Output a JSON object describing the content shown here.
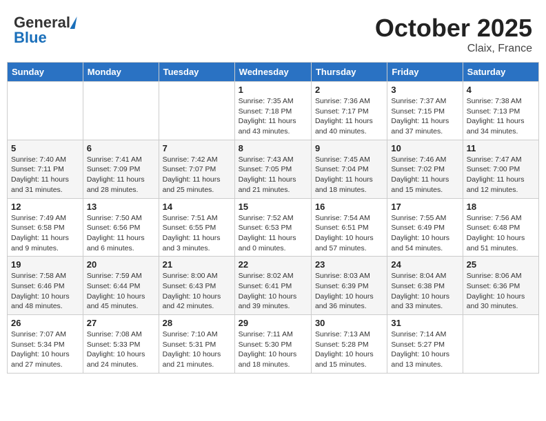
{
  "header": {
    "logo_general": "General",
    "logo_blue": "Blue",
    "month": "October 2025",
    "location": "Claix, France"
  },
  "weekdays": [
    "Sunday",
    "Monday",
    "Tuesday",
    "Wednesday",
    "Thursday",
    "Friday",
    "Saturday"
  ],
  "weeks": [
    [
      {
        "day": "",
        "info": ""
      },
      {
        "day": "",
        "info": ""
      },
      {
        "day": "",
        "info": ""
      },
      {
        "day": "1",
        "info": "Sunrise: 7:35 AM\nSunset: 7:18 PM\nDaylight: 11 hours and 43 minutes."
      },
      {
        "day": "2",
        "info": "Sunrise: 7:36 AM\nSunset: 7:17 PM\nDaylight: 11 hours and 40 minutes."
      },
      {
        "day": "3",
        "info": "Sunrise: 7:37 AM\nSunset: 7:15 PM\nDaylight: 11 hours and 37 minutes."
      },
      {
        "day": "4",
        "info": "Sunrise: 7:38 AM\nSunset: 7:13 PM\nDaylight: 11 hours and 34 minutes."
      }
    ],
    [
      {
        "day": "5",
        "info": "Sunrise: 7:40 AM\nSunset: 7:11 PM\nDaylight: 11 hours and 31 minutes."
      },
      {
        "day": "6",
        "info": "Sunrise: 7:41 AM\nSunset: 7:09 PM\nDaylight: 11 hours and 28 minutes."
      },
      {
        "day": "7",
        "info": "Sunrise: 7:42 AM\nSunset: 7:07 PM\nDaylight: 11 hours and 25 minutes."
      },
      {
        "day": "8",
        "info": "Sunrise: 7:43 AM\nSunset: 7:05 PM\nDaylight: 11 hours and 21 minutes."
      },
      {
        "day": "9",
        "info": "Sunrise: 7:45 AM\nSunset: 7:04 PM\nDaylight: 11 hours and 18 minutes."
      },
      {
        "day": "10",
        "info": "Sunrise: 7:46 AM\nSunset: 7:02 PM\nDaylight: 11 hours and 15 minutes."
      },
      {
        "day": "11",
        "info": "Sunrise: 7:47 AM\nSunset: 7:00 PM\nDaylight: 11 hours and 12 minutes."
      }
    ],
    [
      {
        "day": "12",
        "info": "Sunrise: 7:49 AM\nSunset: 6:58 PM\nDaylight: 11 hours and 9 minutes."
      },
      {
        "day": "13",
        "info": "Sunrise: 7:50 AM\nSunset: 6:56 PM\nDaylight: 11 hours and 6 minutes."
      },
      {
        "day": "14",
        "info": "Sunrise: 7:51 AM\nSunset: 6:55 PM\nDaylight: 11 hours and 3 minutes."
      },
      {
        "day": "15",
        "info": "Sunrise: 7:52 AM\nSunset: 6:53 PM\nDaylight: 11 hours and 0 minutes."
      },
      {
        "day": "16",
        "info": "Sunrise: 7:54 AM\nSunset: 6:51 PM\nDaylight: 10 hours and 57 minutes."
      },
      {
        "day": "17",
        "info": "Sunrise: 7:55 AM\nSunset: 6:49 PM\nDaylight: 10 hours and 54 minutes."
      },
      {
        "day": "18",
        "info": "Sunrise: 7:56 AM\nSunset: 6:48 PM\nDaylight: 10 hours and 51 minutes."
      }
    ],
    [
      {
        "day": "19",
        "info": "Sunrise: 7:58 AM\nSunset: 6:46 PM\nDaylight: 10 hours and 48 minutes."
      },
      {
        "day": "20",
        "info": "Sunrise: 7:59 AM\nSunset: 6:44 PM\nDaylight: 10 hours and 45 minutes."
      },
      {
        "day": "21",
        "info": "Sunrise: 8:00 AM\nSunset: 6:43 PM\nDaylight: 10 hours and 42 minutes."
      },
      {
        "day": "22",
        "info": "Sunrise: 8:02 AM\nSunset: 6:41 PM\nDaylight: 10 hours and 39 minutes."
      },
      {
        "day": "23",
        "info": "Sunrise: 8:03 AM\nSunset: 6:39 PM\nDaylight: 10 hours and 36 minutes."
      },
      {
        "day": "24",
        "info": "Sunrise: 8:04 AM\nSunset: 6:38 PM\nDaylight: 10 hours and 33 minutes."
      },
      {
        "day": "25",
        "info": "Sunrise: 8:06 AM\nSunset: 6:36 PM\nDaylight: 10 hours and 30 minutes."
      }
    ],
    [
      {
        "day": "26",
        "info": "Sunrise: 7:07 AM\nSunset: 5:34 PM\nDaylight: 10 hours and 27 minutes."
      },
      {
        "day": "27",
        "info": "Sunrise: 7:08 AM\nSunset: 5:33 PM\nDaylight: 10 hours and 24 minutes."
      },
      {
        "day": "28",
        "info": "Sunrise: 7:10 AM\nSunset: 5:31 PM\nDaylight: 10 hours and 21 minutes."
      },
      {
        "day": "29",
        "info": "Sunrise: 7:11 AM\nSunset: 5:30 PM\nDaylight: 10 hours and 18 minutes."
      },
      {
        "day": "30",
        "info": "Sunrise: 7:13 AM\nSunset: 5:28 PM\nDaylight: 10 hours and 15 minutes."
      },
      {
        "day": "31",
        "info": "Sunrise: 7:14 AM\nSunset: 5:27 PM\nDaylight: 10 hours and 13 minutes."
      },
      {
        "day": "",
        "info": ""
      }
    ]
  ]
}
